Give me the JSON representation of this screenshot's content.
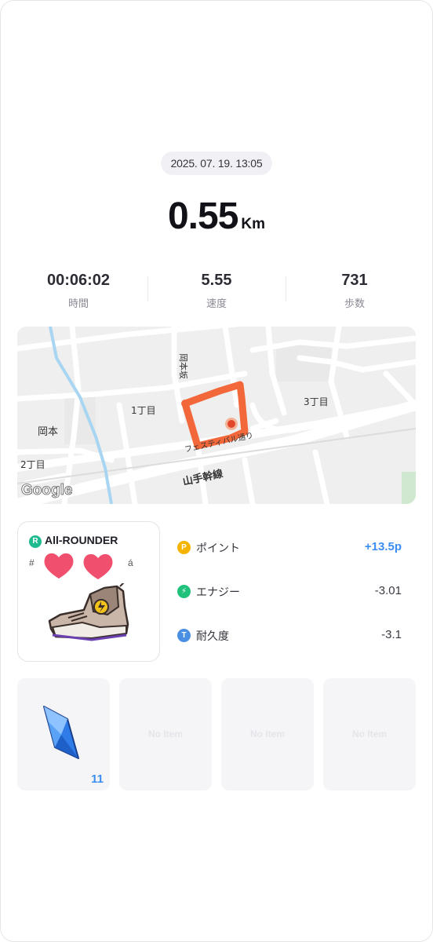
{
  "session": {
    "datetime": "2025. 07. 19. 13:05",
    "distance_value": "0.55",
    "distance_unit": "Km"
  },
  "stats": [
    {
      "value": "00:06:02",
      "label": "時間"
    },
    {
      "value": "5.55",
      "label": "速度"
    },
    {
      "value": "731",
      "label": "歩数"
    }
  ],
  "map": {
    "labels": {
      "okamotozaka": "岡本坂",
      "chome1": "1丁目",
      "chome3": "3丁目",
      "okamoto": "岡本",
      "chome2": "2丁目",
      "festival": "フェスティバル通り",
      "yamate": "山手幹線"
    },
    "logo": "Google",
    "route_color": "#f2683a"
  },
  "shoe": {
    "badge": "R",
    "type": "All-ROUNDER",
    "code": "#",
    "code_tail": "á",
    "icon": "sneaker-icon"
  },
  "metrics": [
    {
      "icon_letter": "P",
      "icon_color": "#f5b400",
      "label": "ポイント",
      "value": "+13.5p",
      "positive": true
    },
    {
      "icon_letter": "⚡",
      "icon_color": "#1fc17b",
      "label": "エナジー",
      "value": "-3.01",
      "positive": false
    },
    {
      "icon_letter": "T",
      "icon_color": "#4a90e2",
      "label": "耐久度",
      "value": "-3.1",
      "positive": false
    }
  ],
  "slots": [
    {
      "icon": "crystal-gem-icon",
      "count": "11"
    },
    {
      "empty_label": "No Item"
    },
    {
      "empty_label": "No Item"
    },
    {
      "empty_label": "No Item"
    }
  ],
  "colors": {
    "accent": "#3c8df2",
    "route": "#f2683a"
  }
}
